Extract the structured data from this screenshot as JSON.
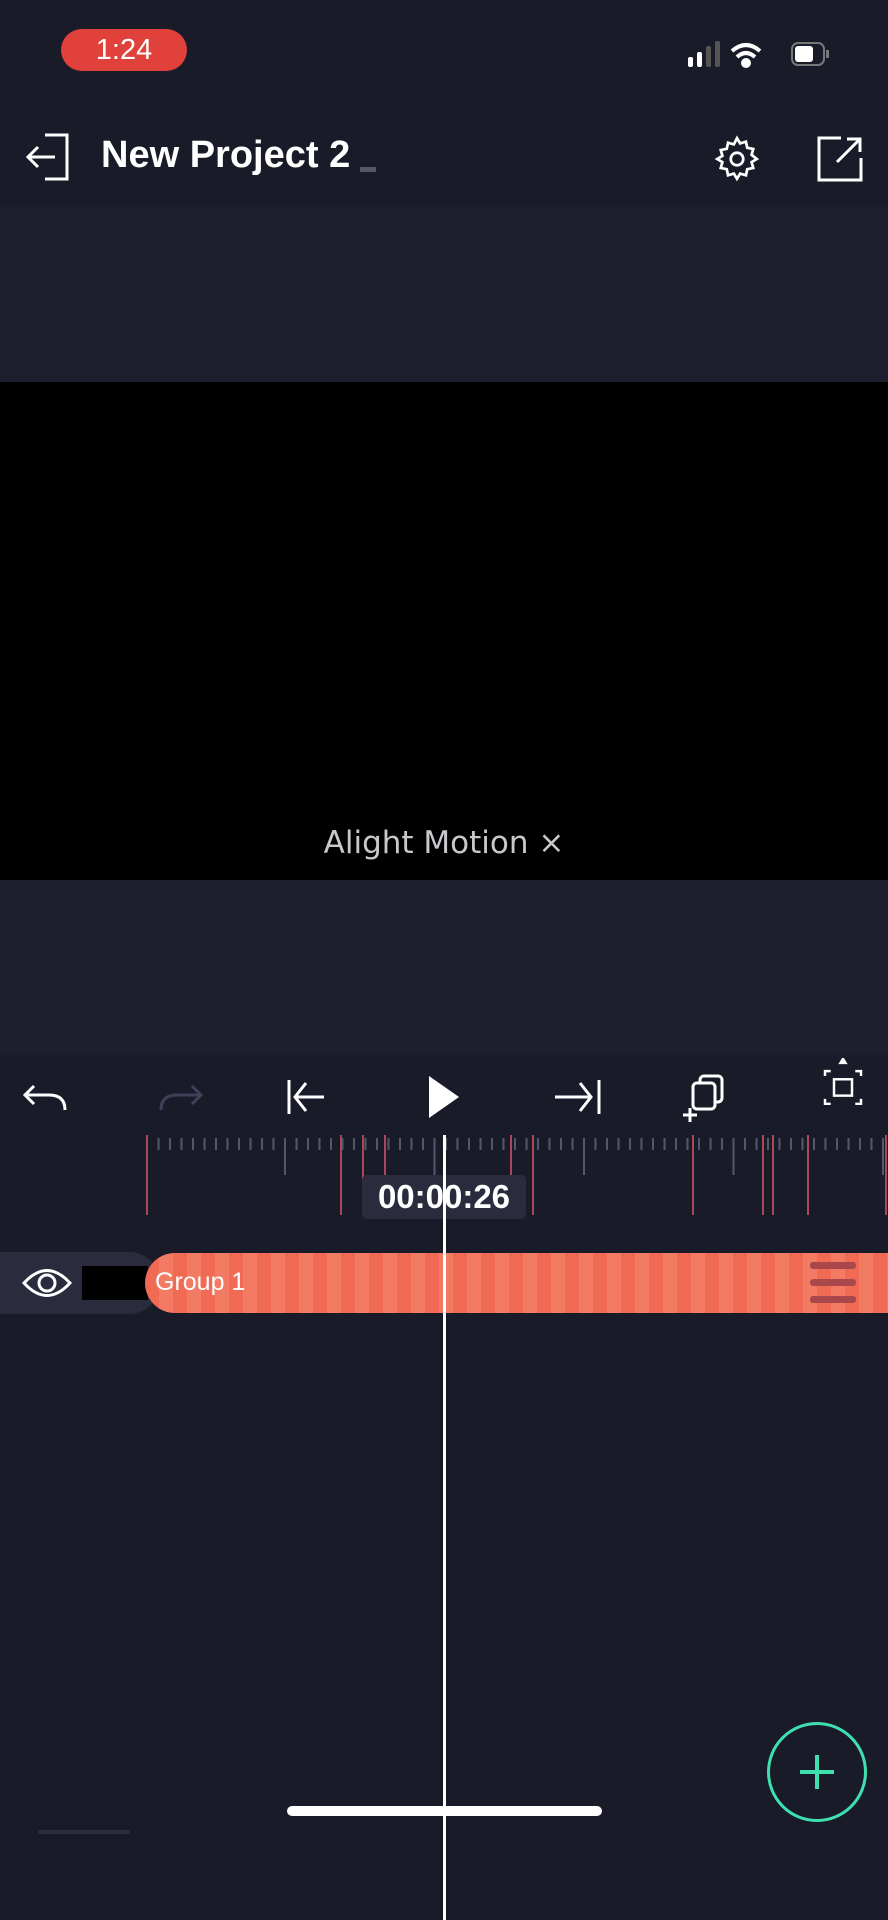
{
  "status_bar": {
    "time": "1:24",
    "time_pill_color": "#e0413a",
    "signal": "signal-icon",
    "wifi": "wifi-icon",
    "battery": "battery-icon"
  },
  "header": {
    "title": "New Project 2",
    "back_icon": "exit-icon",
    "settings_icon": "gear-icon",
    "export_icon": "share-icon"
  },
  "preview": {
    "watermark": "Alight Motion ×"
  },
  "toolbar": {
    "items": [
      "undo",
      "redo",
      "jump-to-start",
      "play",
      "jump-to-end",
      "duplicate-add",
      "fit-frame"
    ]
  },
  "timeline": {
    "timecode": "00:00:26",
    "track": {
      "name": "Group 1",
      "color": "#f06a54"
    }
  },
  "fab": {
    "icon": "plus-icon",
    "color": "#3fe0b0"
  }
}
